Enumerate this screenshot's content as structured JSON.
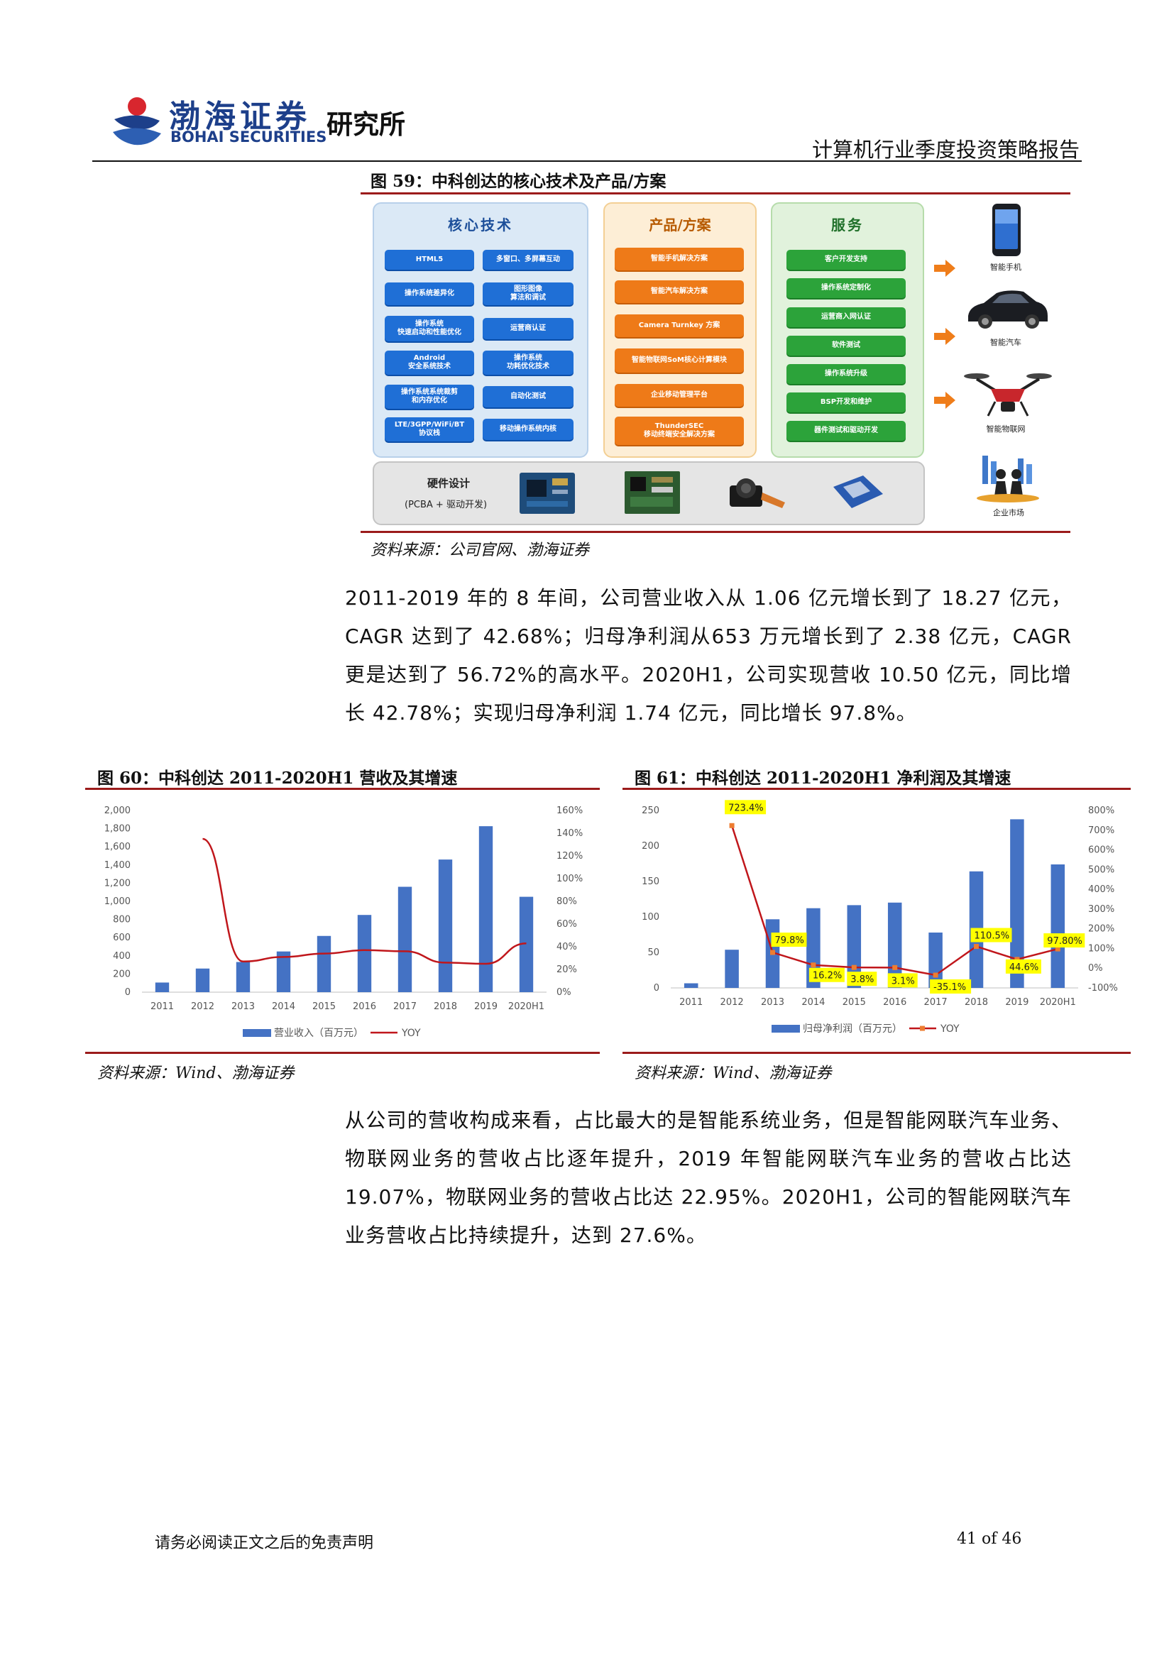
{
  "header": {
    "logo_cn": "渤海证券",
    "logo_en": "BOHAI SECURITIES",
    "institute": "研究所",
    "report_title": "计算机行业季度投资策略报告"
  },
  "figure59": {
    "caption": "图 59：中科创达的核心技术及产品/方案",
    "core_tech": {
      "title": "核心技术",
      "items": [
        "HTML5",
        "多窗口、多屏幕互动",
        "操作系统差异化",
        "图形图像\n算法和调试",
        "操作系统\n快速启动和性能优化",
        "运营商认证",
        "Android\n安全系统技术",
        "操作系统\n功耗优化技术",
        "操作系统系统裁剪\n和内存优化",
        "自动化测试",
        "LTE/3GPP/WiFi/BT\n协议栈",
        "移动操作系统内核"
      ]
    },
    "products": {
      "title": "产品/方案",
      "items": [
        "智能手机解决方案",
        "智能汽车解决方案",
        "Camera Turnkey 方案",
        "智能物联网SoM核心计算模块",
        "企业移动管理平台",
        "ThunderSEC\n移动终端安全解决方案"
      ]
    },
    "services": {
      "title": "服务",
      "items": [
        "客户开发支持",
        "操作系统定制化",
        "运营商入网认证",
        "软件测试",
        "操作系统升级",
        "BSP开发和维护",
        "器件测试和驱动开发"
      ]
    },
    "hardware": {
      "title": "硬件设计",
      "subtitle": "(PCBA + 驱动开发)"
    },
    "markets": [
      "智能手机",
      "智能汽车",
      "智能物联网",
      "企业市场"
    ],
    "source": "资料来源：公司官网、渤海证券"
  },
  "paragraph1": "2011-2019 年的 8 年间，公司营业收入从 1.06 亿元增长到了 18.27 亿元，CAGR 达到了 42.68%；归母净利润从653 万元增长到了 2.38 亿元，CAGR 更是达到了 56.72%的高水平。2020H1，公司实现营收 10.50 亿元，同比增长 42.78%；实现归母净利润 1.74 亿元，同比增长 97.8%。",
  "chart_data": [
    {
      "type": "bar",
      "caption": "图 60：中科创达 2011-2020H1 营收及其增速",
      "categories": [
        "2011",
        "2012",
        "2013",
        "2014",
        "2015",
        "2016",
        "2017",
        "2018",
        "2019",
        "2020H1"
      ],
      "series": [
        {
          "name": "营业收入（百万元）",
          "type": "bar",
          "axis": "left",
          "values": [
            106,
            260,
            332,
            448,
            619,
            850,
            1160,
            1460,
            1827,
            1050
          ]
        },
        {
          "name": "YOY",
          "type": "line",
          "axis": "right",
          "color": "#c0161b",
          "values": [
            null,
            135,
            27,
            31,
            34,
            37,
            36,
            26,
            25,
            43
          ]
        }
      ],
      "y_left": {
        "min": 0,
        "max": 2000,
        "step": 200,
        "ticks": [
          "0",
          "200",
          "400",
          "600",
          "800",
          "1,000",
          "1,200",
          "1,400",
          "1,600",
          "1,800",
          "2,000"
        ]
      },
      "y_right": {
        "min": 0,
        "max": 160,
        "step": 20,
        "ticks": [
          "0%",
          "20%",
          "40%",
          "60%",
          "80%",
          "100%",
          "120%",
          "140%",
          "160%"
        ]
      },
      "legend_position": "bottom",
      "bar_color": "#4472c4",
      "source": "资料来源：Wind、渤海证券"
    },
    {
      "type": "bar",
      "caption": "图 61：中科创达 2011-2020H1 净利润及其增速",
      "categories": [
        "2011",
        "2012",
        "2013",
        "2014",
        "2015",
        "2016",
        "2017",
        "2018",
        "2019",
        "2020H1"
      ],
      "series": [
        {
          "name": "归母净利润（百万元）",
          "type": "bar",
          "axis": "left",
          "values": [
            6.5,
            53.8,
            96.7,
            112.3,
            116.6,
            120.2,
            78,
            164.2,
            237.6,
            174
          ]
        },
        {
          "name": "YOY",
          "type": "line",
          "axis": "right",
          "color": "#c0161b",
          "marker_color": "#ed7d31",
          "values": [
            null,
            723.4,
            79.8,
            16.2,
            3.8,
            3.1,
            -35.1,
            110.5,
            44.6,
            97.8
          ]
        }
      ],
      "data_labels": [
        "723.4%",
        "79.8%",
        "16.2%",
        "3.8%",
        "3.1%",
        "-35.1%",
        "110.5%",
        "44.6%",
        "97.80%"
      ],
      "y_left": {
        "min": 0,
        "max": 250,
        "step": 50,
        "ticks": [
          "0",
          "50",
          "100",
          "150",
          "200",
          "250"
        ]
      },
      "y_right": {
        "min": -100,
        "max": 800,
        "step": 100,
        "ticks": [
          "-100%",
          "0%",
          "100%",
          "200%",
          "300%",
          "400%",
          "500%",
          "600%",
          "700%",
          "800%"
        ]
      },
      "legend_position": "bottom",
      "bar_color": "#4472c4",
      "label_highlight": "#ffff00",
      "source": "资料来源：Wind、渤海证券"
    }
  ],
  "paragraph2": "从公司的营收构成来看，占比最大的是智能系统业务，但是智能网联汽车业务、物联网业务的营收占比逐年提升，2019 年智能网联汽车业务的营收占比达 19.07%，物联网业务的营收占比达 22.95%。2020H1，公司的智能网联汽车业务营收占比持续提升，达到 27.6%。",
  "footer": {
    "disclaimer": "请务必阅读正文之后的免责声明",
    "page": "41 of 46"
  }
}
